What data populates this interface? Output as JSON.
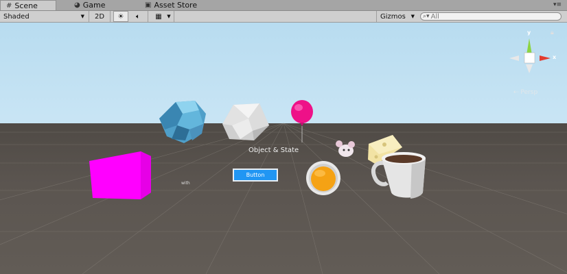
{
  "tabs": [
    {
      "label": "Scene",
      "icon": "grid-icon"
    },
    {
      "label": "Game",
      "icon": "pacman-icon"
    },
    {
      "label": "Asset Store",
      "icon": "bag-icon"
    }
  ],
  "toolbar": {
    "shading_mode": "Shaded",
    "mode_2d": "2D",
    "gizmos_label": "Gizmos",
    "search_placeholder": "All"
  },
  "viewport": {
    "object_state_label": "Object & State",
    "button_label": "Button",
    "tiny_label": "with",
    "projection_label": "Persp",
    "axes": {
      "x": "x",
      "y": "y"
    }
  },
  "colors": {
    "sky": "#cfe8f6",
    "ground": "#5b5550",
    "magenta_cube": "#ff00ff",
    "balloon": "#ee1188",
    "button_blue": "#2196f3",
    "axis_x": "#e33b2e",
    "axis_y": "#8cd440"
  }
}
